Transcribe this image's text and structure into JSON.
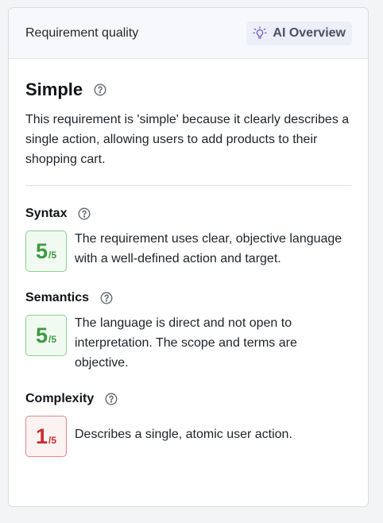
{
  "header": {
    "title": "Requirement quality",
    "ai_button_label": "AI Overview",
    "ai_icon": "lightbulb-icon"
  },
  "quality": {
    "title": "Simple",
    "description": "This requirement is 'simple' because it clearly describes a single action, allowing users to add products to their shopping cart."
  },
  "metrics": [
    {
      "label": "Syntax",
      "score": "5",
      "max": "/5",
      "status": "good",
      "text": "The requirement uses clear, objective language with a well-defined action and target."
    },
    {
      "label": "Semantics",
      "score": "5",
      "max": "/5",
      "status": "good",
      "text": "The language is direct and not open to interpretation. The scope and terms are objective."
    },
    {
      "label": "Complexity",
      "score": "1",
      "max": "/5",
      "status": "bad",
      "text": "Describes a single, atomic user action."
    }
  ],
  "colors": {
    "good": "#3d9a3f",
    "bad": "#c62f2f",
    "ai_button_bg": "#eceef8"
  }
}
